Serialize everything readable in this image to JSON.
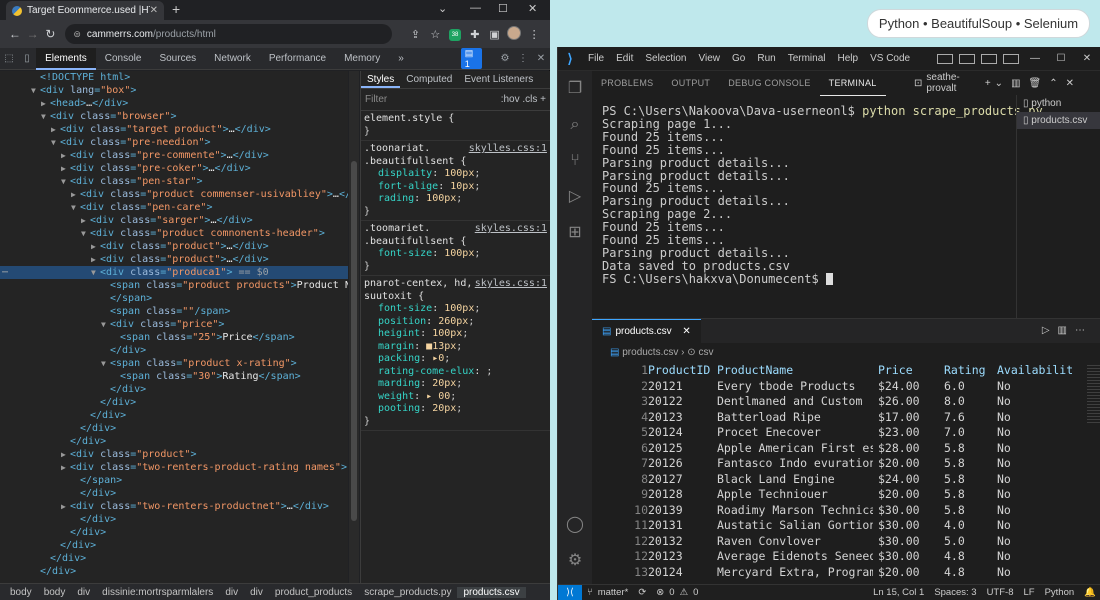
{
  "browser": {
    "tab_title": "Target Eoommerce.used |HTML",
    "url_host": "cammerrs.com",
    "url_path": "/products/html"
  },
  "devtools": {
    "tabs": [
      "Elements",
      "Console",
      "Sources",
      "Network",
      "Performance",
      "Memory"
    ],
    "more": "»",
    "issues_count": "1",
    "dom_lines": [
      {
        "i": 0,
        "parts": [
          [
            "t",
            "<!DOCTYPE html>"
          ]
        ]
      },
      {
        "i": 0,
        "tri": "▼",
        "parts": [
          [
            "t",
            "<div "
          ],
          [
            "a",
            "lang"
          ],
          [
            "t",
            "="
          ],
          [
            "v",
            "\"box\""
          ],
          [
            "t",
            ">"
          ]
        ]
      },
      {
        "i": 1,
        "tri": "▶",
        "parts": [
          [
            "t",
            "<head>"
          ],
          [
            "x",
            "…"
          ],
          [
            "t",
            "</div>"
          ]
        ]
      },
      {
        "i": 1,
        "tri": "▼",
        "parts": [
          [
            "t",
            "<div "
          ],
          [
            "a",
            "class"
          ],
          [
            "t",
            "="
          ],
          [
            "v",
            "\"browser\""
          ],
          [
            "t",
            ">"
          ]
        ]
      },
      {
        "i": 2,
        "tri": "▶",
        "parts": [
          [
            "t",
            "<div "
          ],
          [
            "a",
            "class"
          ],
          [
            "t",
            "="
          ],
          [
            "v",
            "\"target product\""
          ],
          [
            "t",
            ">"
          ],
          [
            "x",
            "…"
          ],
          [
            "t",
            "</div>"
          ]
        ]
      },
      {
        "i": 2,
        "tri": "▼",
        "parts": [
          [
            "t",
            "<div "
          ],
          [
            "a",
            "class"
          ],
          [
            "t",
            "="
          ],
          [
            "v",
            "\"pre-needion\""
          ],
          [
            "t",
            ">"
          ]
        ]
      },
      {
        "i": 3,
        "tri": "▶",
        "parts": [
          [
            "t",
            "<div "
          ],
          [
            "a",
            "class"
          ],
          [
            "t",
            "="
          ],
          [
            "v",
            "\"pre-commente\""
          ],
          [
            "t",
            ">"
          ],
          [
            "x",
            "…"
          ],
          [
            "t",
            "</div>"
          ]
        ]
      },
      {
        "i": 3,
        "tri": "▶",
        "parts": [
          [
            "t",
            "<div "
          ],
          [
            "a",
            "class"
          ],
          [
            "t",
            "="
          ],
          [
            "v",
            "\"pre-coker\""
          ],
          [
            "t",
            ">"
          ],
          [
            "x",
            "…"
          ],
          [
            "t",
            "</div>"
          ]
        ]
      },
      {
        "i": 3,
        "tri": "▼",
        "parts": [
          [
            "t",
            "<div "
          ],
          [
            "a",
            "class"
          ],
          [
            "t",
            "="
          ],
          [
            "v",
            "\"pen-star\""
          ],
          [
            "t",
            ">"
          ]
        ]
      },
      {
        "i": 4,
        "tri": "▶",
        "parts": [
          [
            "t",
            "<div "
          ],
          [
            "a",
            "class"
          ],
          [
            "t",
            "="
          ],
          [
            "v",
            "\"product commenser-usivabliey\""
          ],
          [
            "t",
            ">"
          ],
          [
            "x",
            "…"
          ],
          [
            "t",
            "</div>"
          ]
        ]
      },
      {
        "i": 4,
        "tri": "▼",
        "parts": [
          [
            "t",
            "<div "
          ],
          [
            "a",
            "class"
          ],
          [
            "t",
            "="
          ],
          [
            "v",
            "\"pen-care\""
          ],
          [
            "t",
            ">"
          ]
        ]
      },
      {
        "i": 5,
        "tri": "▶",
        "parts": [
          [
            "t",
            "<div "
          ],
          [
            "a",
            "class"
          ],
          [
            "t",
            "="
          ],
          [
            "v",
            "\"sarger\""
          ],
          [
            "t",
            ">"
          ],
          [
            "x",
            "…"
          ],
          [
            "t",
            "</div>"
          ]
        ]
      },
      {
        "i": 5,
        "tri": "▼",
        "parts": [
          [
            "t",
            "<div "
          ],
          [
            "a",
            "class"
          ],
          [
            "t",
            "="
          ],
          [
            "v",
            "\"product comnonents-header\""
          ],
          [
            "t",
            ">"
          ]
        ]
      },
      {
        "i": 6,
        "tri": "▶",
        "parts": [
          [
            "t",
            "<div "
          ],
          [
            "a",
            "class"
          ],
          [
            "t",
            "="
          ],
          [
            "v",
            "\"product\""
          ],
          [
            "t",
            ">"
          ],
          [
            "x",
            "…"
          ],
          [
            "t",
            "</div>"
          ]
        ]
      },
      {
        "i": 6,
        "tri": "▶",
        "parts": [
          [
            "t",
            "<div "
          ],
          [
            "a",
            "class"
          ],
          [
            "t",
            "="
          ],
          [
            "v",
            "\"product\""
          ],
          [
            "t",
            ">"
          ],
          [
            "x",
            "…"
          ],
          [
            "t",
            "</div>"
          ]
        ]
      },
      {
        "i": 6,
        "tri": "▼",
        "sel": true,
        "parts": [
          [
            "t",
            "<div "
          ],
          [
            "a",
            "class"
          ],
          [
            "t",
            "="
          ],
          [
            "v",
            "\"produca1\""
          ],
          [
            "t",
            ">"
          ],
          [
            "x",
            " == $0"
          ]
        ]
      },
      {
        "i": 7,
        "parts": [
          [
            "t",
            "<span "
          ],
          [
            "a",
            "class"
          ],
          [
            "t",
            "="
          ],
          [
            "v",
            "\"product products\""
          ],
          [
            "t",
            ">"
          ],
          [
            "w",
            "Product Name"
          ]
        ]
      },
      {
        "i": 7,
        "parts": [
          [
            "t",
            "</span>"
          ]
        ]
      },
      {
        "i": 7,
        "parts": [
          [
            "t",
            "<span "
          ],
          [
            "a",
            "class"
          ],
          [
            "t",
            "="
          ],
          [
            "v",
            "\"\""
          ],
          [
            "t",
            "/span>"
          ]
        ]
      },
      {
        "i": 7,
        "tri": "▼",
        "parts": [
          [
            "t",
            "<div "
          ],
          [
            "a",
            "class"
          ],
          [
            "t",
            "="
          ],
          [
            "v",
            "\"price\""
          ],
          [
            "t",
            ">"
          ]
        ]
      },
      {
        "i": 8,
        "parts": [
          [
            "t",
            "<span "
          ],
          [
            "a",
            "class"
          ],
          [
            "t",
            "="
          ],
          [
            "v",
            "\"25\""
          ],
          [
            "t",
            ">"
          ],
          [
            "w",
            "Price"
          ],
          [
            "t",
            "</span>"
          ]
        ]
      },
      {
        "i": 7,
        "parts": [
          [
            "t",
            "</div>"
          ]
        ]
      },
      {
        "i": 7,
        "tri": "▼",
        "parts": [
          [
            "t",
            "<span "
          ],
          [
            "a",
            "class"
          ],
          [
            "t",
            "="
          ],
          [
            "v",
            "\"product x-rating\""
          ],
          [
            "t",
            ">"
          ]
        ]
      },
      {
        "i": 8,
        "parts": [
          [
            "t",
            "<span "
          ],
          [
            "a",
            "class"
          ],
          [
            "t",
            "="
          ],
          [
            "v",
            "\"30\""
          ],
          [
            "t",
            ">"
          ],
          [
            "w",
            "Rating"
          ],
          [
            "t",
            "</span>"
          ]
        ]
      },
      {
        "i": 7,
        "parts": [
          [
            "t",
            "</div>"
          ]
        ]
      },
      {
        "i": 6,
        "parts": [
          [
            "t",
            "</div>"
          ]
        ]
      },
      {
        "i": 5,
        "parts": [
          [
            "t",
            "</div>"
          ]
        ]
      },
      {
        "i": 4,
        "parts": [
          [
            "t",
            "</div>"
          ]
        ]
      },
      {
        "i": 3,
        "parts": [
          [
            "t",
            "</div>"
          ]
        ]
      },
      {
        "i": 3,
        "tri": "▶",
        "parts": [
          [
            "t",
            "<div "
          ],
          [
            "a",
            "class"
          ],
          [
            "t",
            "="
          ],
          [
            "v",
            "\"product\""
          ],
          [
            "t",
            ">"
          ]
        ]
      },
      {
        "i": 3,
        "tri": "▶",
        "parts": [
          [
            "t",
            "<div "
          ],
          [
            "a",
            "class"
          ],
          [
            "t",
            "="
          ],
          [
            "v",
            "\"two-renters-product-rating names\""
          ],
          [
            "t",
            ">"
          ]
        ]
      },
      {
        "i": 4,
        "parts": [
          [
            "t",
            "</span>"
          ]
        ]
      },
      {
        "i": 4,
        "parts": [
          [
            "t",
            "</div>"
          ]
        ]
      },
      {
        "i": 3,
        "tri": "▶",
        "parts": [
          [
            "t",
            "<div "
          ],
          [
            "a",
            "class"
          ],
          [
            "t",
            "="
          ],
          [
            "v",
            "\"two-renters-productnet\""
          ],
          [
            "t",
            ">"
          ],
          [
            "x",
            "…"
          ],
          [
            "t",
            "</div>"
          ]
        ]
      },
      {
        "i": 4,
        "parts": [
          [
            "t",
            "</div>"
          ]
        ]
      },
      {
        "i": 3,
        "parts": [
          [
            "t",
            "</div>"
          ]
        ]
      },
      {
        "i": 2,
        "parts": [
          [
            "t",
            "</div>"
          ]
        ]
      },
      {
        "i": 1,
        "parts": [
          [
            "t",
            "</div>"
          ]
        ]
      },
      {
        "i": 0,
        "parts": [
          [
            "t",
            "</div>"
          ]
        ]
      }
    ],
    "styles_tabs": [
      "Styles",
      "Computed",
      "Event Listeners"
    ],
    "filter_placeholder": "Filter",
    "filter_tools": ":hov  .cls  +",
    "rules": [
      {
        "selector": "element.style {",
        "src": "",
        "props": [],
        "close": "}"
      },
      {
        "selector": ".toonariat.\n.beautifullsent {",
        "src": "skylles.css:1",
        "props": [
          [
            "displaity",
            "100px"
          ],
          [
            "fort-alige",
            "10px"
          ],
          [
            "rading",
            "100px"
          ]
        ],
        "close": "}"
      },
      {
        "selector": ".toomariet.\n.beautifullsent {",
        "src": "skyles.css:1",
        "props": [
          [
            "font-size",
            "100px"
          ]
        ],
        "close": "}"
      },
      {
        "selector": "pnarot-centex, hd,\nsuutoxit {",
        "src": "skyles.css:1",
        "props": [
          [
            "font-size",
            "100px"
          ],
          [
            "position",
            "260px"
          ],
          [
            "heigint",
            "100px"
          ],
          [
            "margin",
            "■13px"
          ],
          [
            "packing",
            "▸0"
          ],
          [
            "rating-come-elux",
            ""
          ],
          [
            "marding",
            "20px"
          ],
          [
            "weight",
            "▸ 00"
          ],
          [
            "pooting",
            "20px"
          ]
        ],
        "close": "}"
      }
    ],
    "breadcrumbs": [
      "body",
      "body",
      "div",
      "dissinie:mortrsparmlalers",
      "div",
      "div",
      "product_products",
      "scrape_products.py",
      "products.csv"
    ]
  },
  "top_badge": "Python • BeautifulSoup • Selenium",
  "vscode": {
    "menu": [
      "File",
      "Edit",
      "Selection",
      "View",
      "Go",
      "Run",
      "Terminal",
      "Help",
      "VS Code"
    ],
    "panel_tabs": [
      "PROBLEMS",
      "OUTPUT",
      "DEBUG CONSOLE",
      "TERMINAL"
    ],
    "terminal_name": "seathe-provalt",
    "terminal_lines": [
      {
        "kind": "cmd",
        "prompt": "PS C:\\Users\\Nakoova\\Dava-userneonl$ ",
        "text": "python scrape_products.py"
      },
      {
        "kind": "out",
        "text": "Scraping page 1..."
      },
      {
        "kind": "out",
        "text": "Found 25 items..."
      },
      {
        "kind": "out",
        "text": "Found 25 items..."
      },
      {
        "kind": "out",
        "text": "Parsing product details..."
      },
      {
        "kind": "out",
        "text": "Parsing product details..."
      },
      {
        "kind": "out",
        "text": "Found 25 items..."
      },
      {
        "kind": "out",
        "text": "Parsing product details..."
      },
      {
        "kind": "out",
        "text": "Scraping page 2..."
      },
      {
        "kind": "out",
        "text": "Found 25 items..."
      },
      {
        "kind": "out",
        "text": "Found 25 items..."
      },
      {
        "kind": "out",
        "text": "Parsing product details..."
      },
      {
        "kind": "out",
        "text": "Data saved to products.csv"
      },
      {
        "kind": "prompt",
        "text": "FS C:\\Users\\hakxva\\Donumecent$ "
      }
    ],
    "side_files": [
      "python",
      "products.csv"
    ],
    "editor_tab": "products.csv",
    "editor_crumb": [
      "products.csv",
      "csv"
    ],
    "csv_header": {
      "ln": "1",
      "cells": [
        "ProductID",
        "ProductName",
        "Price",
        "Rating",
        "Availability"
      ]
    },
    "csv_rows": [
      {
        "ln": "2",
        "cells": [
          "20121",
          "Every tbode Products",
          "$24.00",
          "6.0",
          "No"
        ]
      },
      {
        "ln": "3",
        "cells": [
          "20122",
          "Dentlmaned and Custom",
          "$26.00",
          "8.0",
          "No"
        ]
      },
      {
        "ln": "4",
        "cells": [
          "20123",
          "Batterload Ripe",
          "$17.00",
          "7.6",
          "No"
        ]
      },
      {
        "ln": "5",
        "cells": [
          "20124",
          "Procet Enecover",
          "$23.00",
          "7.0",
          "No"
        ]
      },
      {
        "ln": "6",
        "cells": [
          "20125",
          "Apple American First es",
          "$28.00",
          "5.8",
          "No"
        ]
      },
      {
        "ln": "7",
        "cells": [
          "20126",
          "Fantasco Indo evuration",
          "$20.00",
          "5.8",
          "No"
        ]
      },
      {
        "ln": "8",
        "cells": [
          "20127",
          "Black Land Engine",
          "$24.00",
          "5.8",
          "No"
        ]
      },
      {
        "ln": "9",
        "cells": [
          "20128",
          "Apple Techniouer",
          "$20.00",
          "5.8",
          "No"
        ]
      },
      {
        "ln": "10",
        "cells": [
          "20139",
          "Roadimy Marson Technica",
          "$30.00",
          "5.8",
          "No"
        ]
      },
      {
        "ln": "11",
        "cells": [
          "20131",
          "Austatic Salian Gortion",
          "$30.00",
          "4.0",
          "No"
        ]
      },
      {
        "ln": "12",
        "cells": [
          "20132",
          "Raven Convlover",
          "$30.00",
          "5.0",
          "No"
        ]
      },
      {
        "ln": "12",
        "cells": [
          "20123",
          "Average Eidenots Seneed",
          "$30.00",
          "4.8",
          "No"
        ]
      },
      {
        "ln": "13",
        "cells": [
          "20124",
          "Mercyard Extra, Program",
          "$20.00",
          "4.8",
          "No"
        ]
      }
    ],
    "status": {
      "branch": "matter*",
      "errors": "0",
      "warnings": "0",
      "position": "Ln 15, Col 1",
      "spaces": "Spaces: 3",
      "encoding": "UTF-8",
      "eol": "LF",
      "language": "Python"
    }
  },
  "colors": {
    "accent": "#0078d4",
    "selection": "#244a74"
  }
}
